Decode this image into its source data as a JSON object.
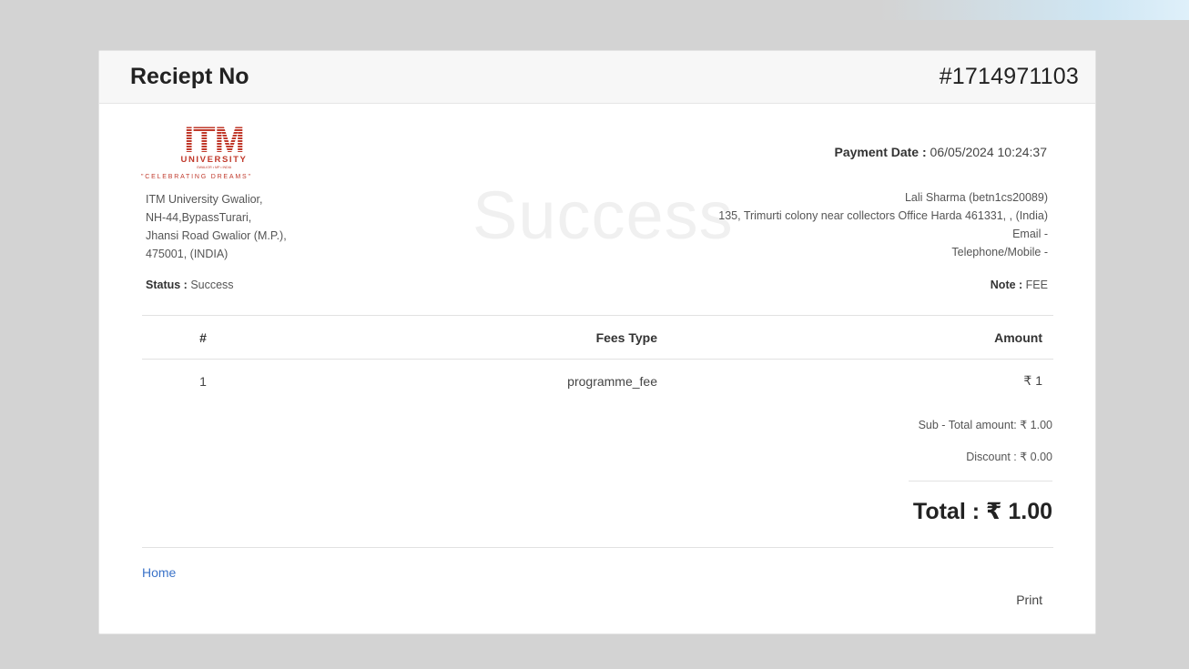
{
  "receipt": {
    "title": "Reciept No",
    "number": "#1714971103"
  },
  "logo": {
    "name": "ITM",
    "subtitle": "UNIVERSITY",
    "location": "GWALIOR • MP • INDIA",
    "tagline": "\"CELEBRATING DREAMS\"",
    "brand_color": "#c0392b"
  },
  "university_address": {
    "line1": "ITM University Gwalior,",
    "line2": "NH-44,BypassTurari,",
    "line3": "Jhansi Road Gwalior (M.P.),",
    "line4": "475001, (INDIA)"
  },
  "watermark": "Success",
  "payment": {
    "date_label": "Payment Date :",
    "date_value": " 06/05/2024 10:24:37"
  },
  "customer": {
    "name": "Lali Sharma (betn1cs20089)",
    "address": "135, Trimurti colony near collectors Office Harda 461331, , (India)",
    "email": "Email -",
    "phone": "Telephone/Mobile -"
  },
  "status": {
    "label": "Status :",
    "value": " Success"
  },
  "note": {
    "label": "Note :",
    "value": " FEE"
  },
  "table": {
    "headers": {
      "num": "#",
      "type": "Fees Type",
      "amount": "Amount"
    },
    "rows": [
      {
        "num": "1",
        "type": "programme_fee",
        "amount": "₹ 1"
      }
    ]
  },
  "summary": {
    "subtotal": "Sub - Total amount: ₹ 1.00",
    "discount": "Discount : ₹ 0.00",
    "total": "Total : ₹ 1.00"
  },
  "actions": {
    "home_label": "Home",
    "print_label": "Print"
  }
}
